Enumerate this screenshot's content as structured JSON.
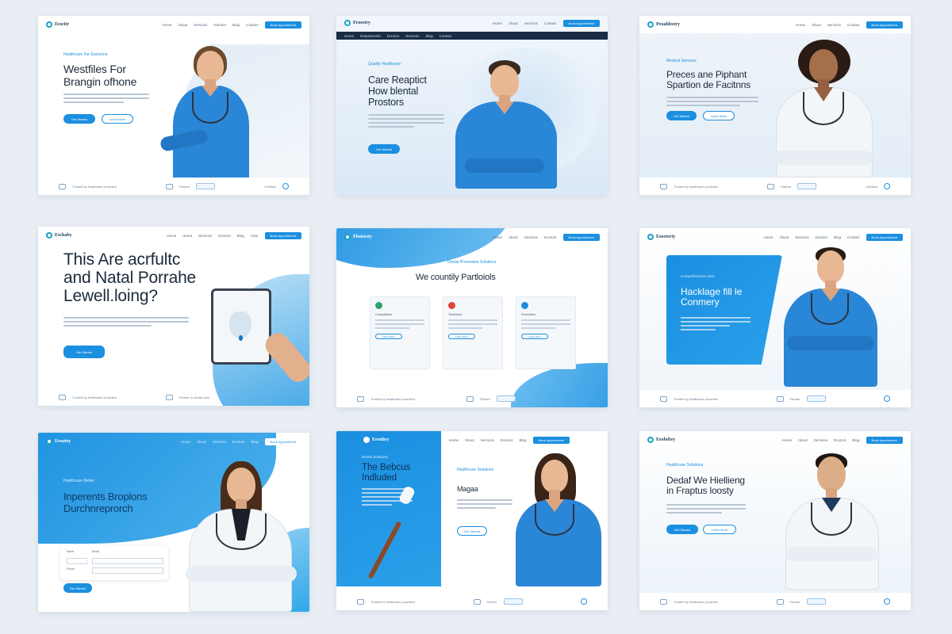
{
  "colors": {
    "page_bg": "#e9eef4",
    "accent": "#1b8fe0",
    "headline": "#1c2a3a",
    "scrub_blue": "#2a86d6",
    "coat_white": "#f3f6f9"
  },
  "cards": [
    {
      "logo": "Eeseitr",
      "nav_links": [
        "Home",
        "About",
        "Services",
        "Doctors",
        "Blog",
        "Contact"
      ],
      "cta": "Book Appointment",
      "eyebrow": "Healthcare For Everyone",
      "headline": "Westfiles For\nBrangin ofhone",
      "primary_btn": "Get Started",
      "secondary_btn": "Learn More",
      "footer_left": "Trusted by healthcare providers",
      "footer_mid": "Partner",
      "footer_right": "Certified"
    },
    {
      "logo": "Froestry",
      "nav_links": [
        "Home",
        "About",
        "Services",
        "Contact"
      ],
      "cta": "Book Appointment",
      "subnav": [
        "Home",
        "Departments",
        "Doctors",
        "Services",
        "Blog",
        "Contact"
      ],
      "eyebrow": "Quality Healthcare",
      "headline": "Care Reaptict\nHow blental\nProstors",
      "primary_btn": "Get Started"
    },
    {
      "logo": "Peoaldestry",
      "nav_links": [
        "Home",
        "About",
        "Services",
        "Contact"
      ],
      "cta": "Book Appointment",
      "eyebrow": "Medical Services",
      "headline": "Preces ane Piphant\nSpartion de Facitnns",
      "primary_btn": "Get Started",
      "secondary_btn": "Learn More",
      "footer_left": "Trusted by healthcare providers",
      "footer_mid": "Partner",
      "footer_right": "Certified"
    },
    {
      "logo": "Eschaby",
      "nav_links": [
        "Home",
        "About",
        "Services",
        "Doctors",
        "Blog",
        "Care"
      ],
      "cta": "Book Appointment",
      "headline": "This Are acrfultc\nand Natal Porrahe\nLewell.loing?",
      "primary_btn": "Get Started",
      "footer_left": "Trusted by healthcare providers",
      "footer_mid": "Partner in dental care"
    },
    {
      "logo": "Fhsioesty",
      "nav_links": [
        "Home",
        "About",
        "Services",
        "Doctors"
      ],
      "cta": "Book Appointment",
      "eyebrow": "Dental Preventive Solutions",
      "headline": "We countily Partloiols",
      "feature_titles": [
        "Consultation",
        "Treatment",
        "Prevention"
      ],
      "feature_btn": "Learn More",
      "footer_left": "Trusted by healthcare providers",
      "footer_mid": "Partner"
    },
    {
      "logo": "Eoseterty",
      "nav_links": [
        "Home",
        "About",
        "Services",
        "Doctors",
        "Blog",
        "Contact"
      ],
      "cta": "Book Appointment",
      "eyebrow": "Comprehensive Care",
      "headline": "Hacklage fill le\nConmery",
      "footer_left": "Trusted by healthcare providers",
      "footer_mid": "Partner"
    },
    {
      "logo": "Eesatuy",
      "nav_links": [
        "Home",
        "About",
        "Services",
        "Doctors",
        "Blog"
      ],
      "cta": "Book Appointment",
      "eyebrow": "Healthcare Better",
      "headline": "Inperents Broplons\nDurchnreprorch",
      "form_labels": [
        "Name",
        "Email",
        "Phone"
      ],
      "primary_btn": "Get Started"
    },
    {
      "logo": "Eesuhey",
      "nav_links": [
        "Home",
        "About",
        "Services",
        "Doctors",
        "Blog"
      ],
      "cta": "Book Appointment",
      "panel_eyebrow": "Dental Solutions",
      "panel_headline": "The Bebcus\nIndluded",
      "eyebrow": "Healthcare Solutions",
      "headline": "Magaa",
      "primary_btn": "Get Started",
      "footer_left": "Trusted by healthcare providers",
      "footer_mid": "Partner"
    },
    {
      "logo": "Eeoloftey",
      "nav_links": [
        "Home",
        "About",
        "Services",
        "Doctors",
        "Blog"
      ],
      "cta": "Book Appointment",
      "eyebrow": "Healthcare Solutions",
      "headline": "Dedaf We Hiellieng\nin Fraptus loosty",
      "primary_btn": "Get Started",
      "secondary_btn": "Learn More",
      "footer_left": "Trusted by healthcare providers",
      "footer_mid": "Partner"
    }
  ]
}
